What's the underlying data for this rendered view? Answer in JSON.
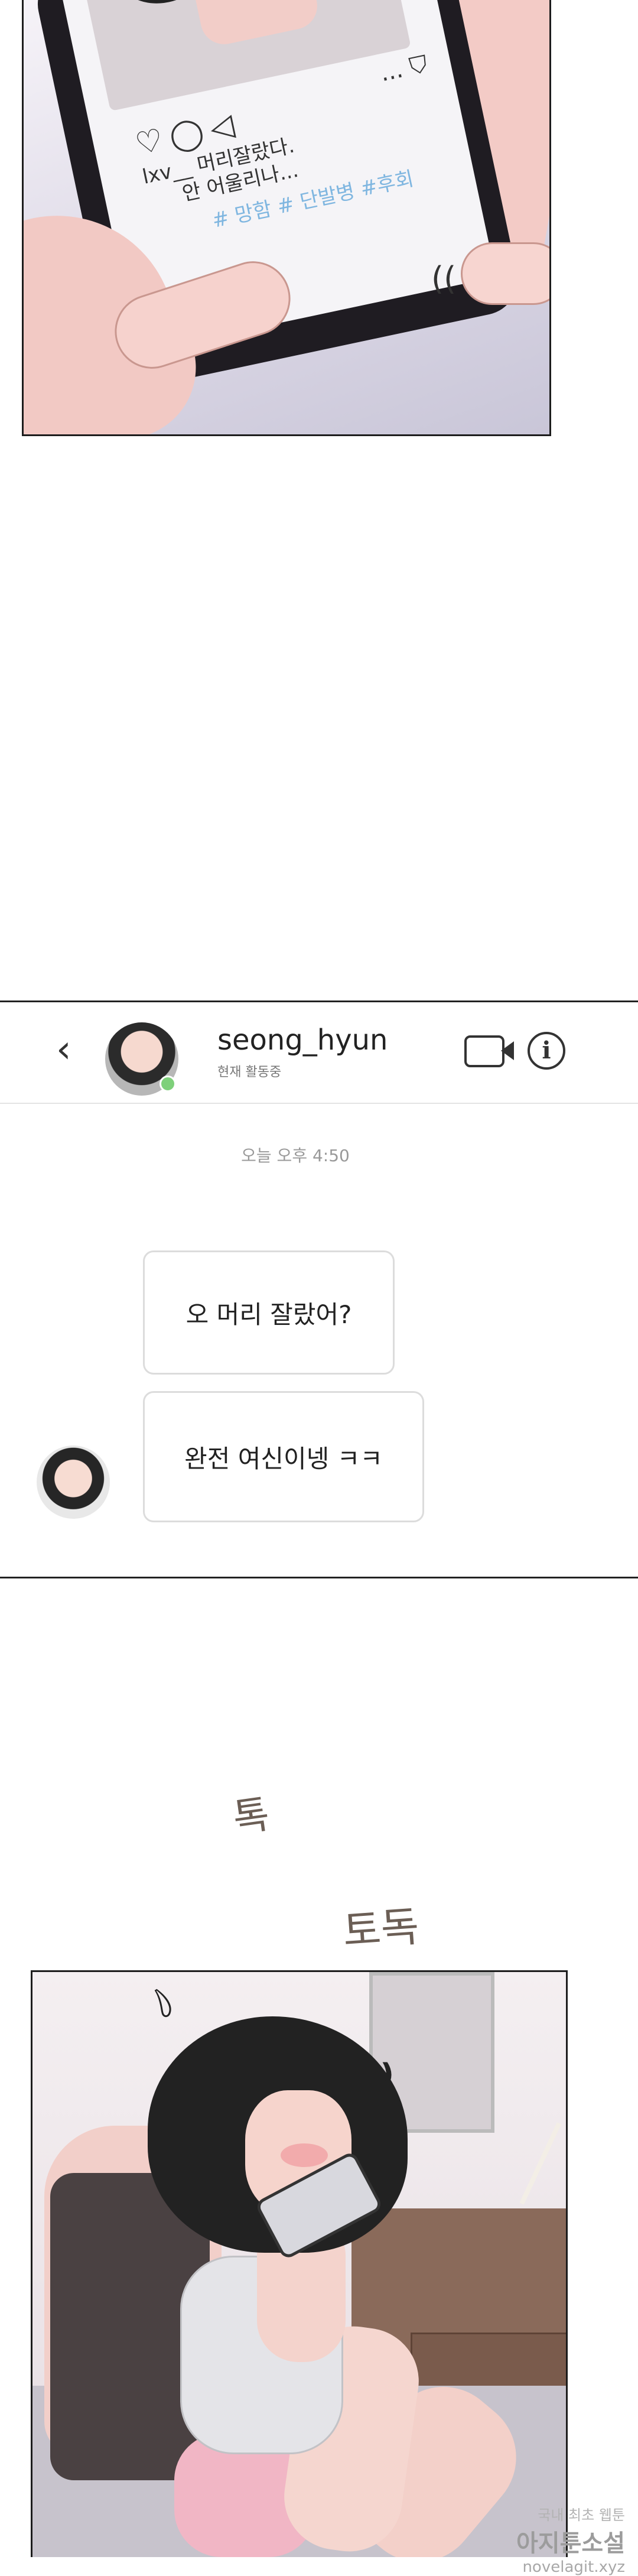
{
  "panel1": {
    "caption_line1": "lxv__ 머리잘랐다.",
    "caption_line2": "안 어울리나...",
    "hashtags": "# 망함 # 단발병 #후회",
    "menu_glyph": "...",
    "tap_glyph": "(("
  },
  "chat": {
    "back_glyph": "‹",
    "username": "seong_hyun",
    "status": "현재 활동중",
    "info_glyph": "i",
    "timestamp": "오늘 오후 4:50",
    "messages": [
      {
        "text": "오 머리 잘랐어?"
      },
      {
        "text": "완전 여신이넹 ㅋㅋ"
      }
    ]
  },
  "sfx": {
    "first": "톡",
    "second": "토독"
  },
  "panel3": {
    "mark1": "﹆",
    "mark2": "❫"
  },
  "watermark": {
    "line1": "국내 최초 웹툰",
    "line2": "아지툰소설",
    "line3": "novelagit.xyz"
  },
  "colors": {
    "border": "#222222",
    "bubble_border": "#dcdcdc",
    "online_dot": "#7ed07a",
    "hashtag": "#7fb6e0",
    "sfx": "#6b5e55"
  }
}
